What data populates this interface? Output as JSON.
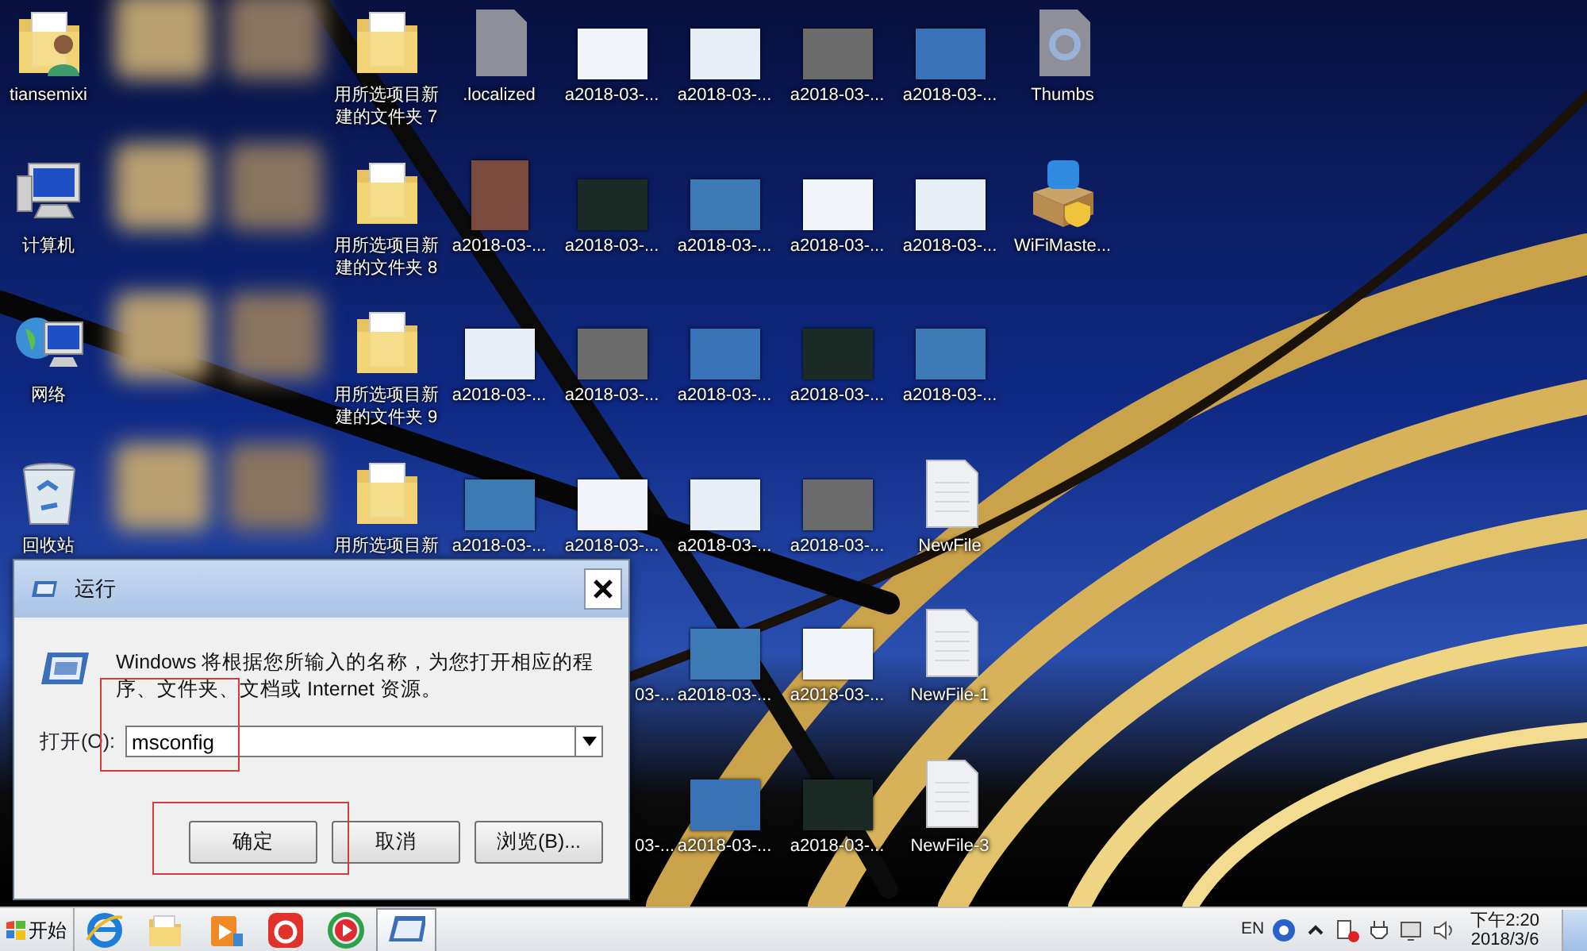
{
  "desktop": {
    "rows": [
      [
        {
          "kind": "user-folder",
          "label": "tiansemixi"
        },
        {
          "kind": "blurred"
        },
        {
          "kind": "blurred"
        },
        {
          "kind": "folder",
          "label": "用所选项目新建的文件夹 7"
        },
        {
          "kind": "blank-file",
          "label": ".localized"
        },
        {
          "kind": "screenshot",
          "label": "a2018-03-..."
        },
        {
          "kind": "screenshot",
          "label": "a2018-03-..."
        },
        {
          "kind": "screenshot",
          "label": "a2018-03-..."
        },
        {
          "kind": "screenshot",
          "label": "a2018-03-..."
        },
        {
          "kind": "settings-file",
          "label": "Thumbs"
        }
      ],
      [
        {
          "kind": "computer",
          "label": "计算机"
        },
        {
          "kind": "blurred"
        },
        {
          "kind": "blurred"
        },
        {
          "kind": "folder",
          "label": "用所选项目新建的文件夹 8"
        },
        {
          "kind": "photo",
          "label": "a2018-03-..."
        },
        {
          "kind": "screenshot",
          "label": "a2018-03-..."
        },
        {
          "kind": "screenshot",
          "label": "a2018-03-..."
        },
        {
          "kind": "screenshot",
          "label": "a2018-03-..."
        },
        {
          "kind": "screenshot",
          "label": "a2018-03-..."
        },
        {
          "kind": "installer",
          "label": "WiFiMaste..."
        }
      ],
      [
        {
          "kind": "network",
          "label": "网络"
        },
        {
          "kind": "blurred"
        },
        {
          "kind": "blurred"
        },
        {
          "kind": "folder",
          "label": "用所选项目新建的文件夹 9"
        },
        {
          "kind": "screenshot",
          "label": "a2018-03-..."
        },
        {
          "kind": "screenshot",
          "label": "a2018-03-..."
        },
        {
          "kind": "screenshot",
          "label": "a2018-03-..."
        },
        {
          "kind": "screenshot",
          "label": "a2018-03-..."
        },
        {
          "kind": "screenshot",
          "label": "a2018-03-..."
        }
      ],
      [
        {
          "kind": "recycle-bin",
          "label": "回收站"
        },
        {
          "kind": "blurred"
        },
        {
          "kind": "blurred"
        },
        {
          "kind": "folder",
          "label": "用所选项目新"
        },
        {
          "kind": "screenshot",
          "label": "a2018-03-..."
        },
        {
          "kind": "screenshot",
          "label": "a2018-03-..."
        },
        {
          "kind": "screenshot",
          "label": "a2018-03-..."
        },
        {
          "kind": "screenshot",
          "label": "a2018-03-..."
        },
        {
          "kind": "text-file",
          "label": "NewFile"
        }
      ],
      [
        {
          "kind": "covered"
        },
        {
          "kind": "covered"
        },
        {
          "kind": "covered"
        },
        {
          "kind": "covered"
        },
        {
          "kind": "covered"
        },
        {
          "kind": "partial",
          "label": "03-..."
        },
        {
          "kind": "screenshot",
          "label": "a2018-03-..."
        },
        {
          "kind": "screenshot",
          "label": "a2018-03-..."
        },
        {
          "kind": "text-file",
          "label": "NewFile-1"
        }
      ],
      [
        {
          "kind": "covered"
        },
        {
          "kind": "covered"
        },
        {
          "kind": "covered"
        },
        {
          "kind": "covered"
        },
        {
          "kind": "covered"
        },
        {
          "kind": "partial",
          "label": "03-..."
        },
        {
          "kind": "screenshot",
          "label": "a2018-03-..."
        },
        {
          "kind": "screenshot",
          "label": "a2018-03-..."
        },
        {
          "kind": "text-file",
          "label": "NewFile-3"
        }
      ]
    ]
  },
  "run_dialog": {
    "title": "运行",
    "description": "Windows 将根据您所输入的名称，为您打开相应的程序、文件夹、文档或 Internet 资源。",
    "open_label": "打开(O):",
    "command": "msconfig",
    "buttons": [
      {
        "label": "确定",
        "highlighted": true
      },
      {
        "label": "取消",
        "highlighted": false
      },
      {
        "label": "浏览(B)...",
        "highlighted": false
      }
    ]
  },
  "taskbar": {
    "start_label": "开始",
    "apps": [
      {
        "kind": "browser",
        "selected": false
      },
      {
        "kind": "folder",
        "selected": false
      },
      {
        "kind": "player",
        "selected": false
      },
      {
        "kind": "music",
        "selected": false
      },
      {
        "kind": "video",
        "selected": false
      },
      {
        "kind": "run",
        "selected": true
      }
    ],
    "language": "EN",
    "tray": [
      {
        "kind": "help"
      },
      {
        "kind": "chevron"
      },
      {
        "kind": "network"
      },
      {
        "kind": "usb"
      },
      {
        "kind": "monitor"
      },
      {
        "kind": "speaker"
      }
    ],
    "time": "下午2:20",
    "date": "2018/3/6"
  }
}
